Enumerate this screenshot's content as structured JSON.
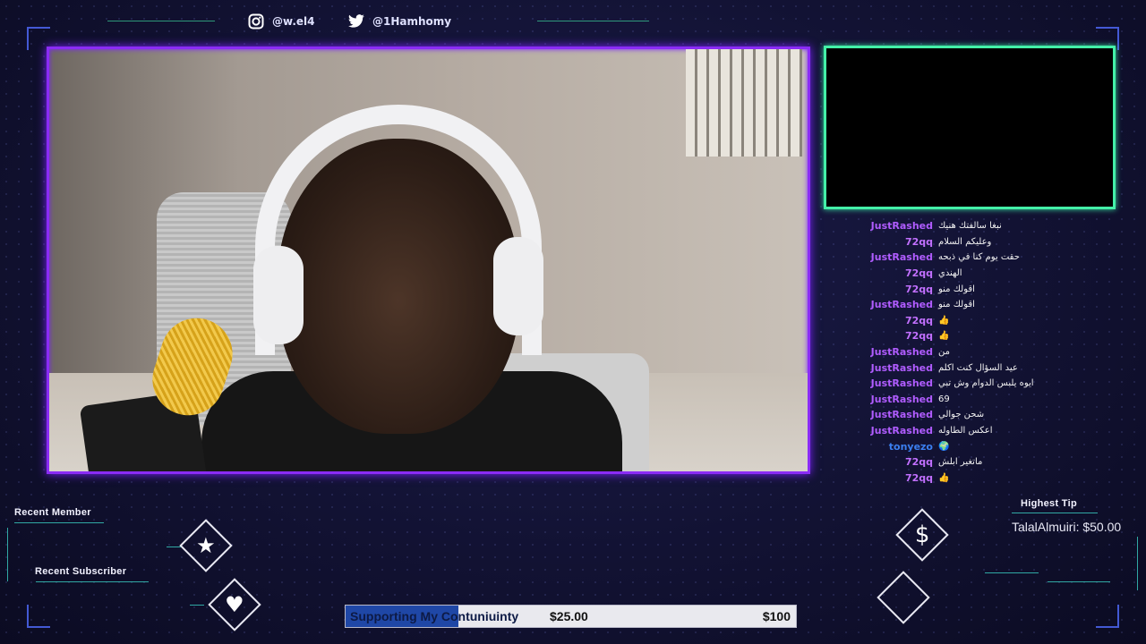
{
  "social": {
    "instagram": "@w.el4",
    "twitter": "@1Hamhomy"
  },
  "chat": [
    {
      "name": "JustRashed",
      "color": "#b05cff",
      "message": "نبغا سالفتك هنيك"
    },
    {
      "name": "72qq",
      "color": "#c270ff",
      "message": "وعليكم السلام"
    },
    {
      "name": "JustRashed",
      "color": "#b05cff",
      "message": "حقت يوم كنا في ذبحه"
    },
    {
      "name": "72qq",
      "color": "#c270ff",
      "message": "الهندي"
    },
    {
      "name": "72qq",
      "color": "#c270ff",
      "message": "اقولك منو"
    },
    {
      "name": "JustRashed",
      "color": "#b05cff",
      "message": "اقولك منو"
    },
    {
      "name": "72qq",
      "color": "#c270ff",
      "message": "👍"
    },
    {
      "name": "72qq",
      "color": "#c270ff",
      "message": "👍"
    },
    {
      "name": "JustRashed",
      "color": "#b05cff",
      "message": "من"
    },
    {
      "name": "JustRashed",
      "color": "#b05cff",
      "message": "عيد السؤال كنت اكلم"
    },
    {
      "name": "JustRashed",
      "color": "#b05cff",
      "message": "ايوه يلبس الدوام وش تبي"
    },
    {
      "name": "JustRashed",
      "color": "#b05cff",
      "message": "69"
    },
    {
      "name": "JustRashed",
      "color": "#b05cff",
      "message": "شحن جوالي"
    },
    {
      "name": "JustRashed",
      "color": "#b05cff",
      "message": "اعكس الطاوله"
    },
    {
      "name": "tonyezo",
      "color": "#3b7ff0",
      "message": "🌍"
    },
    {
      "name": "72qq",
      "color": "#c270ff",
      "message": "ماتغير ابلش"
    },
    {
      "name": "72qq",
      "color": "#c270ff",
      "message": "👍"
    }
  ],
  "widgets": {
    "recent_member_label": "Recent Member",
    "recent_subscriber_label": "Recent Subscriber",
    "highest_tip_label": "Highest Tip",
    "highest_tip_value": "TalalAlmuiri: $50.00",
    "star_icon": "★",
    "heart_icon": "♥",
    "dollar_icon": "$"
  },
  "goal": {
    "label": "Supporting My Contuniuinty",
    "current": "$25.00",
    "target": "$100",
    "progress": 0.25,
    "fill_color": "#1f47a6"
  }
}
